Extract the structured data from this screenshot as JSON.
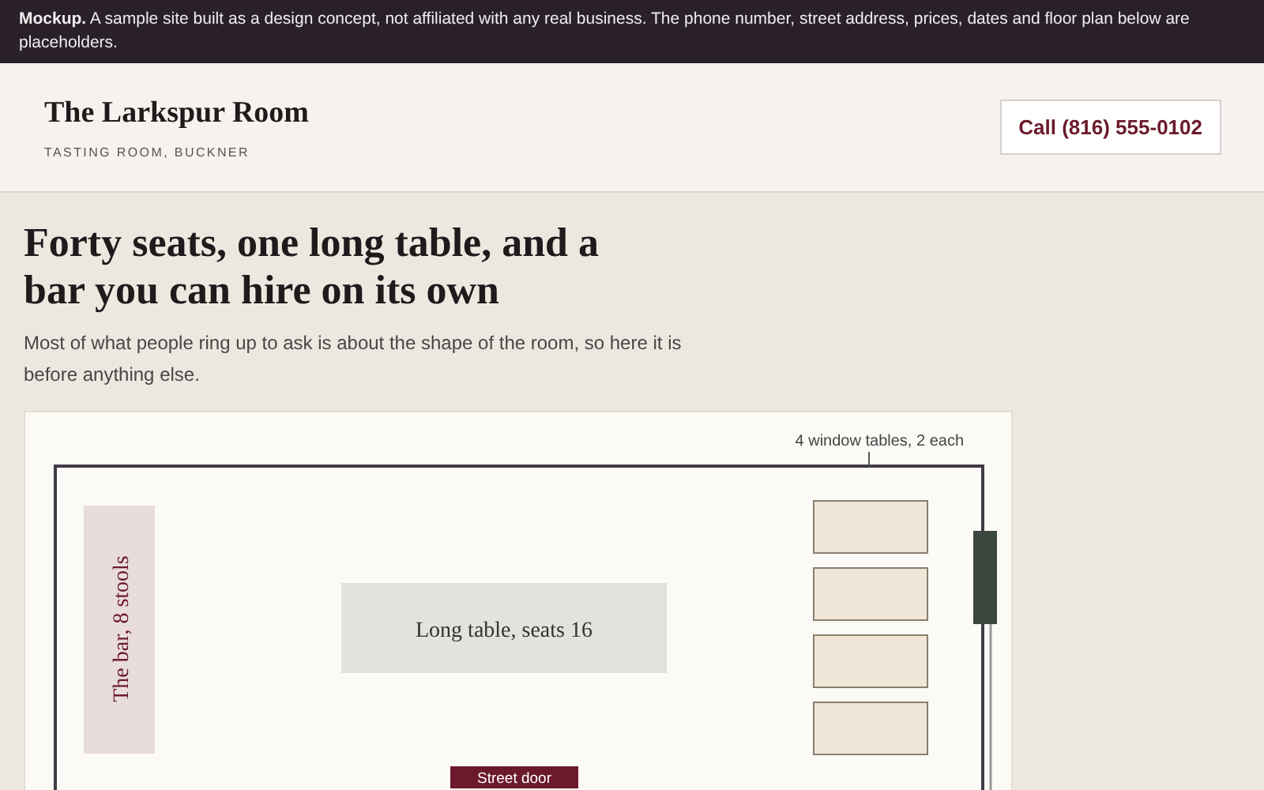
{
  "banner": {
    "text": "**Mockup.** A sample site built as a design concept, not affiliated with any real business. The phone number, street address, prices, dates and floor plan below are placeholders."
  },
  "header": {
    "title": "The Larkspur Room",
    "subtitle": "TASTING ROOM, BUCKNER",
    "call_button": "Call (816) 555-0102"
  },
  "hero": {
    "heading": "Forty seats, one long table, and a bar you can hire on its own",
    "intro": "Most of what people ring up to ask is about the shape of the room, so here it is before anything else."
  },
  "floor_plan": {
    "window_tables_label": "4 window tables, 2 each",
    "bar_label": "The bar, 8 stools",
    "long_table_label": "Long table, seats 16",
    "door_label": "Street door"
  }
}
